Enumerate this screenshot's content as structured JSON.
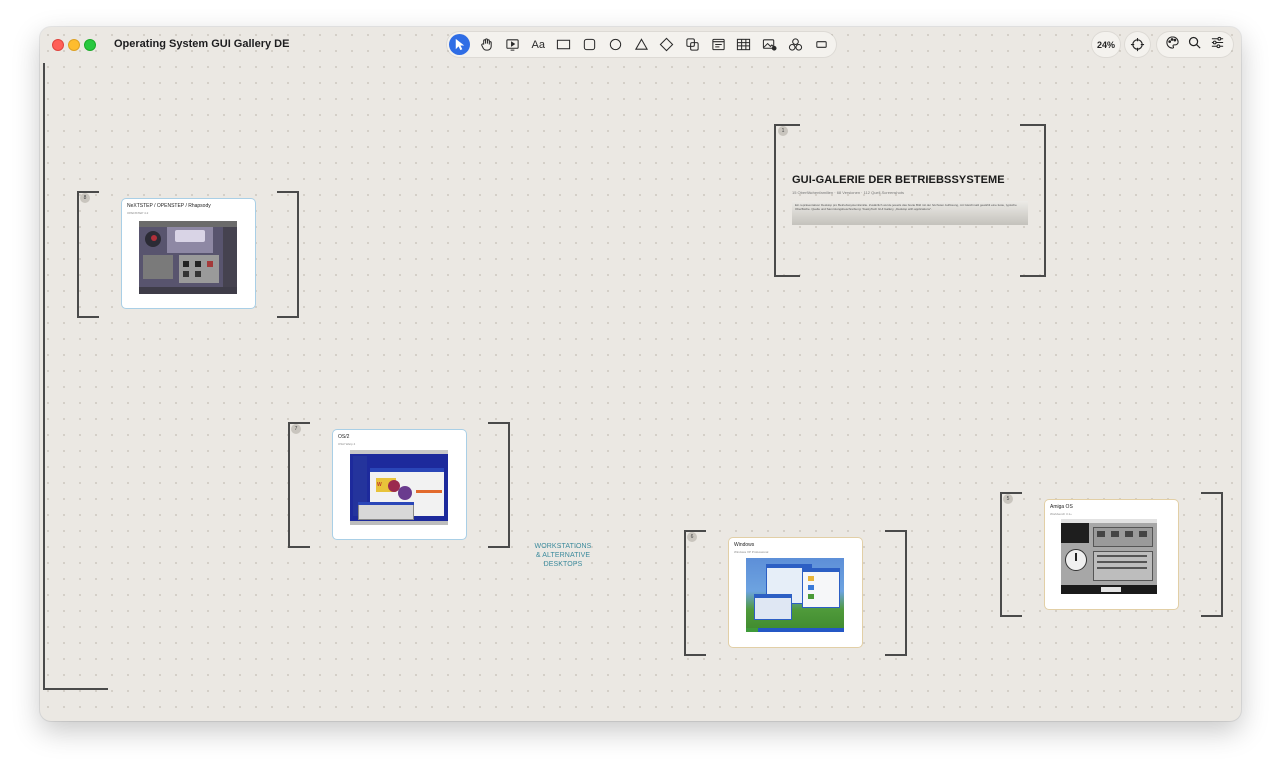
{
  "window": {
    "title": "Operating System GUI Gallery DE"
  },
  "toolbar": {
    "tools": [
      {
        "name": "select-tool",
        "icon": "arrow-pointer-icon"
      },
      {
        "name": "hand-tool",
        "icon": "hand-icon"
      },
      {
        "name": "presentation-tool",
        "icon": "play-frame-icon"
      },
      {
        "name": "text-tool",
        "label": "Aa"
      },
      {
        "name": "rectangle-tool",
        "icon": "rectangle-icon"
      },
      {
        "name": "rounded-rectangle-tool",
        "icon": "rounded-rectangle-icon"
      },
      {
        "name": "ellipse-tool",
        "icon": "circle-icon"
      },
      {
        "name": "triangle-tool",
        "icon": "triangle-icon"
      },
      {
        "name": "diamond-tool",
        "icon": "diamond-icon"
      },
      {
        "name": "shapes-tool",
        "icon": "overlapping-shapes-icon"
      },
      {
        "name": "note-tool",
        "icon": "note-icon"
      },
      {
        "name": "table-tool",
        "icon": "table-icon"
      },
      {
        "name": "image-tool",
        "icon": "image-add-icon"
      },
      {
        "name": "components-tool",
        "icon": "components-icon"
      },
      {
        "name": "frame-tool",
        "icon": "frame-icon"
      }
    ],
    "zoom": "24%"
  },
  "colors": {
    "accent": "#2f6de5",
    "canvas": "#ebe8e3",
    "section_label": "#3b8a9c"
  },
  "title_frame": {
    "number": "1",
    "title": "GUI-GALERIE DER BETRIEBSSYSTEME",
    "subtitle": "15 Oberflächenfamilien · 68 Versionen · 112 Quell-Screenshots",
    "description": "Ein repräsentativer Desktop pro Betriebssystemfamilie. Zusätzlich wurde jeweils das breite Bild mit der höchsten Auflösung, mit Gleichmaß gewählt eine feste, typische Oberfläche. Quelle und Sammlungsbeschreibung: ToastyTech GUI Gallery, „Desktop with applications\"."
  },
  "frames": [
    {
      "number": "8",
      "title": "NeXTSTEP / OPENSTEP / Rhapsody",
      "subtitle": "OPENSTEP 4.2"
    },
    {
      "number": "7",
      "title": "OS/2",
      "subtitle": "OS/2 Warp 4"
    },
    {
      "number": "6",
      "title": "Windows",
      "subtitle": "Windows XP Professional"
    },
    {
      "number": "5",
      "title": "Amiga OS",
      "subtitle": "Workbench 3.1+"
    }
  ],
  "section_label": {
    "line1": "WORKSTATIONS",
    "line2": "& ALTERNATIVE",
    "line3": "DESKTOPS"
  }
}
